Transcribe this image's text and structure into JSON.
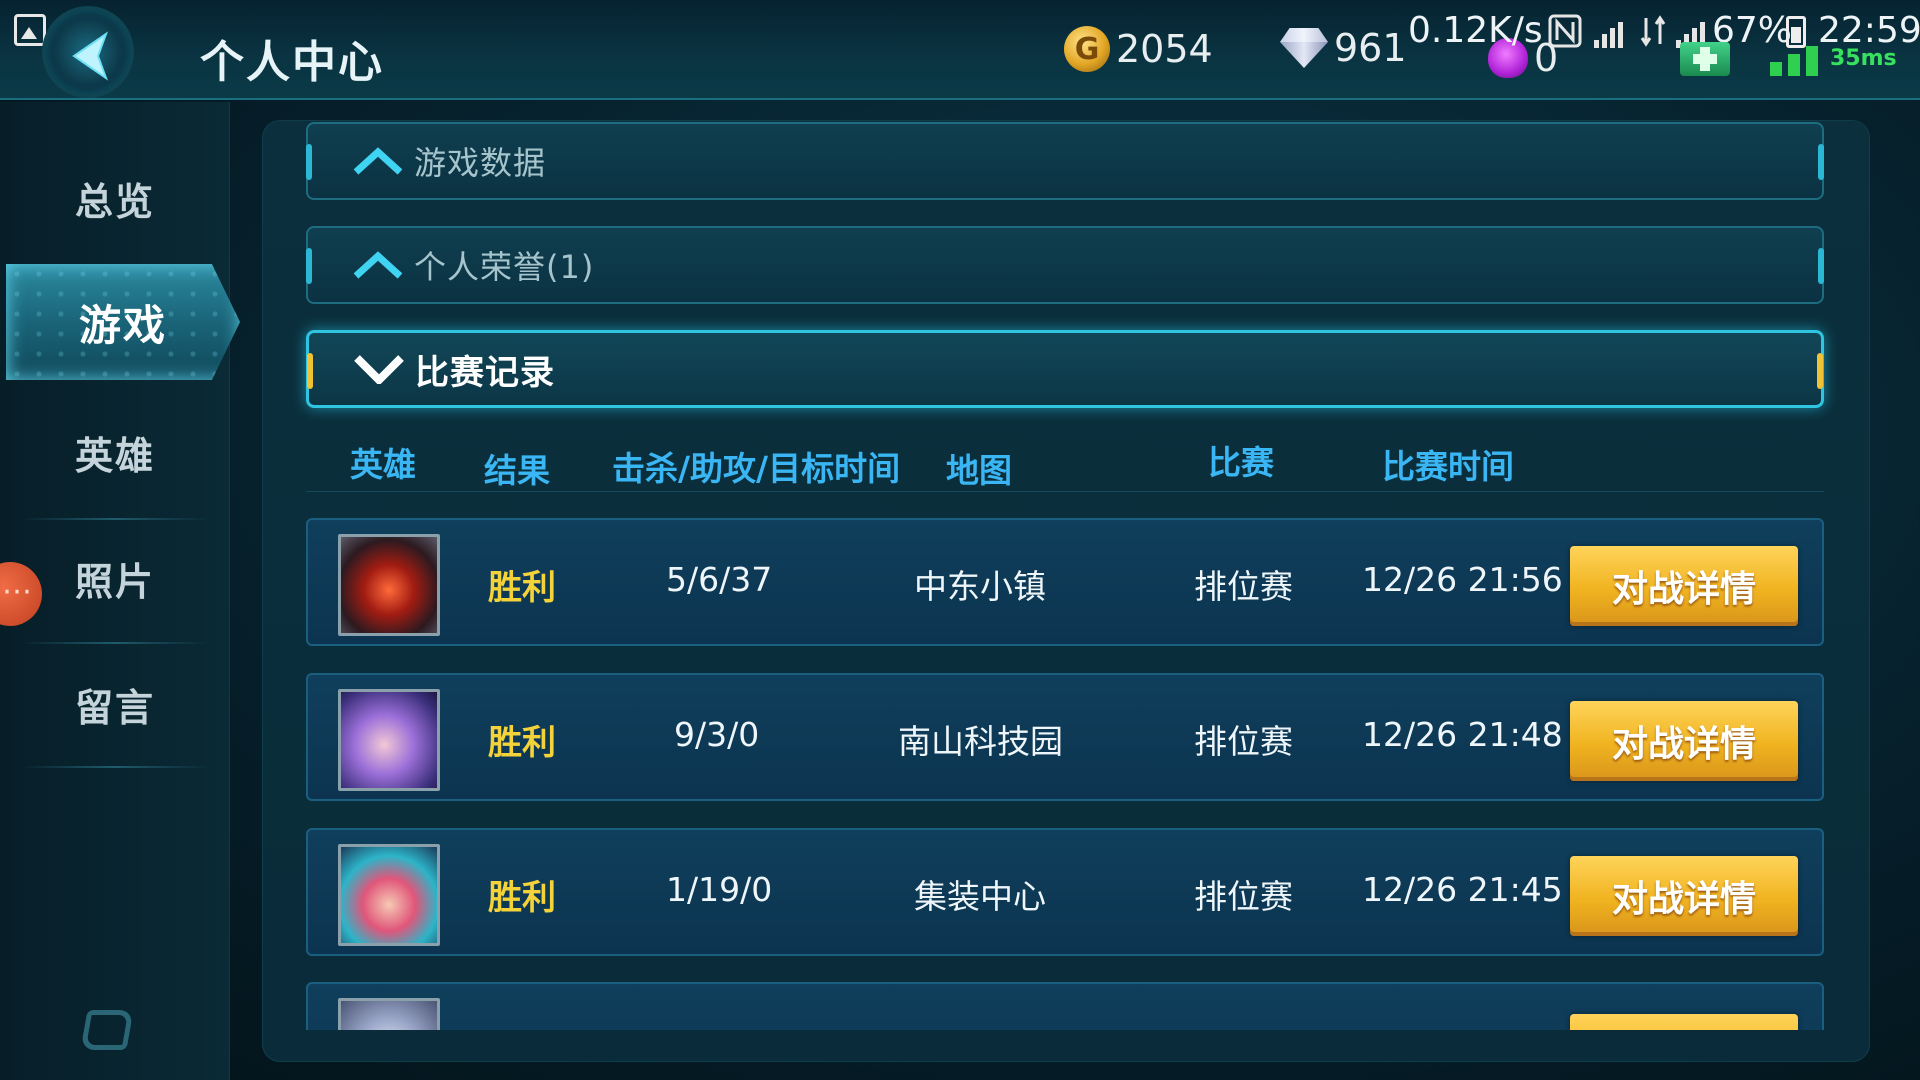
{
  "status": {
    "net_speed": "0.12K/s",
    "battery": "67%",
    "time": "22:59",
    "ping": "35ms"
  },
  "header": {
    "title": "个人中心",
    "gold": "2054",
    "diamonds": "961",
    "gems": "0",
    "coin_glyph": "G"
  },
  "sidebar": {
    "items": [
      {
        "label": "总览"
      },
      {
        "label": "游戏"
      },
      {
        "label": "英雄"
      },
      {
        "label": "照片"
      },
      {
        "label": "留言"
      }
    ],
    "active_index": 1
  },
  "sections": [
    {
      "label": "游戏数据",
      "expanded": false
    },
    {
      "label": "个人荣誉(1)",
      "expanded": false
    },
    {
      "label": "比赛记录",
      "expanded": true
    }
  ],
  "table": {
    "columns": [
      "英雄",
      "结果",
      "击杀/助攻/目标时间",
      "地图",
      "比赛",
      "比赛时间"
    ],
    "detail_label": "对战详情",
    "rows": [
      {
        "result": "胜利",
        "kda": "5/6/37",
        "map": "中东小镇",
        "mode": "排位赛",
        "time": "12/26 21:56"
      },
      {
        "result": "胜利",
        "kda": "9/3/0",
        "map": "南山科技园",
        "mode": "排位赛",
        "time": "12/26 21:48"
      },
      {
        "result": "胜利",
        "kda": "1/19/0",
        "map": "集装中心",
        "mode": "排位赛",
        "time": "12/26 21:45"
      }
    ]
  },
  "colors": {
    "accent_cyan": "#2fc4df",
    "header_text_blue": "#3ab6f4",
    "win_yellow": "#f4d23a",
    "button_gold": "#f0b320"
  }
}
